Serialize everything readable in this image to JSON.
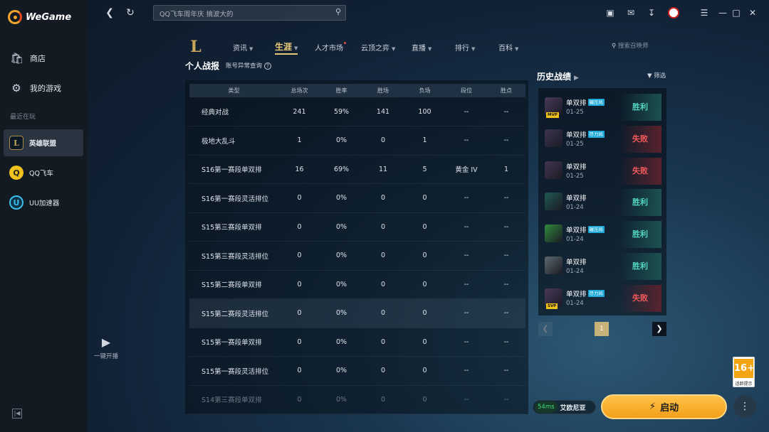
{
  "app": {
    "name": "WeGame"
  },
  "sidebar": {
    "nav": [
      {
        "label": "商店",
        "icon": "store-icon"
      },
      {
        "label": "我的游戏",
        "icon": "my-games-icon"
      }
    ],
    "section_label": "最近在玩",
    "games": [
      {
        "label": "英雄联盟",
        "active": true
      },
      {
        "label": "QQ飞车",
        "active": false
      },
      {
        "label": "UU加速器",
        "active": false
      }
    ],
    "stream_label": "一键开播"
  },
  "topbar": {
    "search_placeholder": "QQ飞车周年庆 搞波大的"
  },
  "game_nav": {
    "items": [
      {
        "label": "资讯",
        "has_caret": true
      },
      {
        "label": "生涯",
        "has_caret": true,
        "active": true
      },
      {
        "label": "人才市场",
        "has_dot": true
      },
      {
        "label": "云顶之弈",
        "has_caret": true
      },
      {
        "label": "直播",
        "has_caret": true
      },
      {
        "label": "排行",
        "has_caret": true
      },
      {
        "label": "百科",
        "has_caret": true
      }
    ],
    "summoner_search_placeholder": "搜索召唤师"
  },
  "stats_panel": {
    "title": "个人战报",
    "subtitle": "账号异常查询",
    "columns": [
      "类型",
      "总场次",
      "胜率",
      "胜场",
      "负场",
      "段位",
      "胜点"
    ],
    "rows": [
      [
        "经典对战",
        "241",
        "59%",
        "141",
        "100",
        "--",
        "--"
      ],
      [
        "极地大乱斗",
        "1",
        "0%",
        "0",
        "1",
        "--",
        "--"
      ],
      [
        "S16第一赛段单双排",
        "16",
        "69%",
        "11",
        "5",
        "黄金 IV",
        "1"
      ],
      [
        "S16第一赛段灵活排位",
        "0",
        "0%",
        "0",
        "0",
        "--",
        "--"
      ],
      [
        "S15第三赛段单双排",
        "0",
        "0%",
        "0",
        "0",
        "--",
        "--"
      ],
      [
        "S15第三赛段灵活排位",
        "0",
        "0%",
        "0",
        "0",
        "--",
        "--"
      ],
      [
        "S15第二赛段单双排",
        "0",
        "0%",
        "0",
        "0",
        "--",
        "--"
      ],
      [
        "S15第二赛段灵活排位",
        "0",
        "0%",
        "0",
        "0",
        "--",
        "--"
      ],
      [
        "S15第一赛段单双排",
        "0",
        "0%",
        "0",
        "0",
        "--",
        "--"
      ],
      [
        "S15第一赛段灵活排位",
        "0",
        "0%",
        "0",
        "0",
        "--",
        "--"
      ],
      [
        "S14第三赛段单双排",
        "0",
        "0%",
        "0",
        "0",
        "--",
        "--"
      ]
    ]
  },
  "history": {
    "title": "历史战绩",
    "filter_label": "筛选",
    "matches": [
      {
        "mode": "单双排",
        "tag": "碾压局",
        "date": "01-25",
        "result": "胜利",
        "win": true,
        "badge": "MVP",
        "champ_color": "#4a3a5a"
      },
      {
        "mode": "单双排",
        "tag": "尽力局",
        "date": "01-25",
        "result": "失败",
        "win": false,
        "badge": "",
        "champ_color": "#3d3550"
      },
      {
        "mode": "单双排",
        "tag": "",
        "date": "01-25",
        "result": "失败",
        "win": false,
        "badge": "",
        "champ_color": "#443650"
      },
      {
        "mode": "单双排",
        "tag": "",
        "date": "01-24",
        "result": "胜利",
        "win": true,
        "badge": "",
        "champ_color": "#1f5a55"
      },
      {
        "mode": "单双排",
        "tag": "碾压局",
        "date": "01-24",
        "result": "胜利",
        "win": true,
        "badge": "",
        "champ_color": "#2f8a3c"
      },
      {
        "mode": "单双排",
        "tag": "",
        "date": "01-24",
        "result": "胜利",
        "win": true,
        "badge": "",
        "champ_color": "#5c6a70"
      },
      {
        "mode": "单双排",
        "tag": "尽力局",
        "date": "01-24",
        "result": "失败",
        "win": false,
        "badge": "SVP",
        "champ_color": "#4a3a5a"
      }
    ],
    "page": "1"
  },
  "bottom": {
    "ping": "54ms",
    "server": "艾欧尼亚",
    "launch_label": "启动",
    "age_rating": "16+",
    "age_label": "适龄提示"
  },
  "colors": {
    "accent": "#f2a019",
    "win": "#52d7c0",
    "lose": "#f25a5a",
    "nav_active": "#e8c979"
  }
}
